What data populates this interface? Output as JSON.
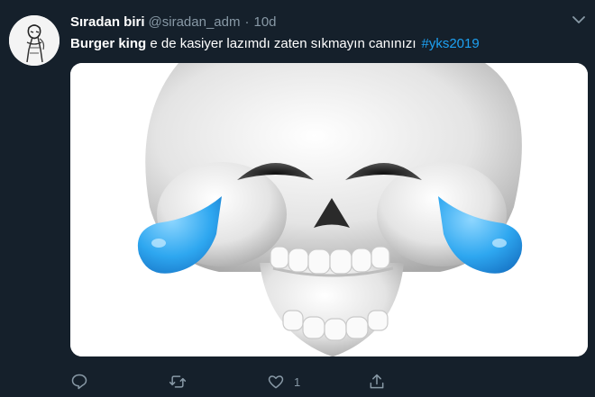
{
  "tweet": {
    "author_name": "Sıradan biri",
    "author_handle": "@siradan_adm",
    "separator": "·",
    "time": "10d",
    "text_bold": "Burger king",
    "text_rest": " e de kasiyer lazımdı zaten sıkmayın canınızı",
    "hashtag": "#yks2019"
  },
  "actions": {
    "reply_icon": "reply-icon",
    "retweet_icon": "retweet-icon",
    "like_icon": "heart-icon",
    "like_count": "1",
    "share_icon": "share-icon"
  },
  "colors": {
    "background": "#15202b",
    "secondary_text": "#8899a6",
    "link": "#1da1f2"
  }
}
